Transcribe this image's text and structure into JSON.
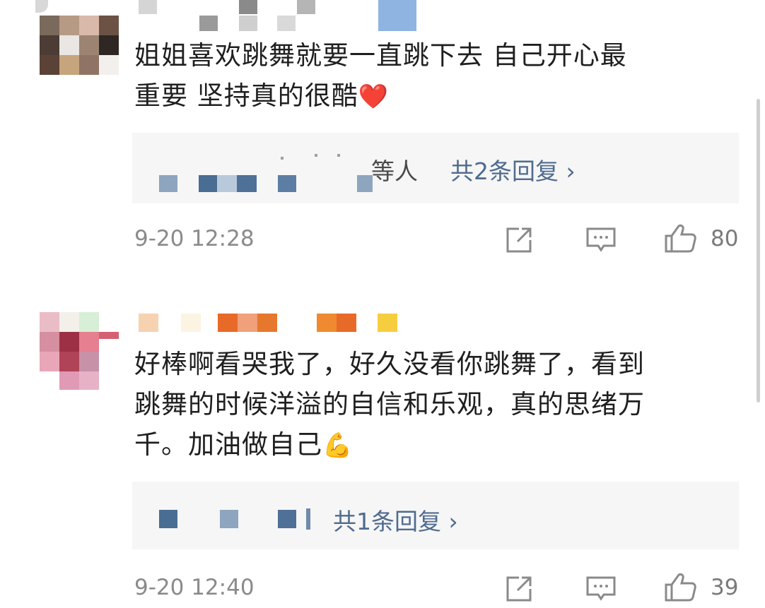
{
  "comments": [
    {
      "text_line1": "姐姐喜欢跳舞就要一直跳下去 自己开心最",
      "text_line2": "重要 坚持真的很酷",
      "emoji": "❤️",
      "reply_prefix": "等人",
      "reply_link": "共2条回复 ›",
      "timestamp": "9-20 12:28",
      "likes": "80"
    },
    {
      "text_line1": "好棒啊看哭我了，好久没看你跳舞了，看到",
      "text_line2": "跳舞的时候洋溢的自信和乐观，真的思绪万",
      "text_line3": "千。加油做自己",
      "emoji": "💪",
      "reply_link": "共1条回复 ›",
      "timestamp": "9-20 12:40",
      "likes": "39"
    }
  ],
  "colors": {
    "link": "#4f6b8f",
    "timestamp": "#8a8a8a",
    "reply_bg": "#f6f6f6",
    "heart": "#e0301e",
    "muscle": "#f5b400"
  },
  "icons": [
    "share-icon",
    "comment-icon",
    "like-icon"
  ]
}
